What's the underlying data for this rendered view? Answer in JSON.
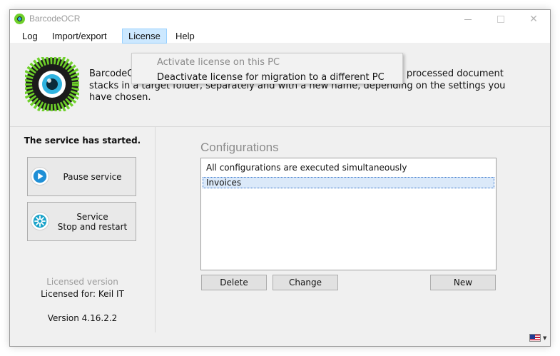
{
  "window": {
    "title": "BarcodeOCR"
  },
  "menu": {
    "log": "Log",
    "import_export": "Import/export",
    "license": "License",
    "help": "Help"
  },
  "license_menu": {
    "activate": "Activate license on this PC",
    "deactivate": "Deactivate license for migration to a different PC"
  },
  "description": "BarcodeOCR monitors input folders you have specified and files the processed document stacks in a target folder, separately and with a new name, depending on the settings you have chosen.",
  "service": {
    "status": "The service has started.",
    "pause_label": "Pause service",
    "restart_line1": "Service",
    "restart_line2": "Stop and restart"
  },
  "license": {
    "licensed_version": "Licensed version",
    "licensed_for": "Licensed for: Keil IT",
    "version": "Version 4.16.2.2"
  },
  "configurations": {
    "title": "Configurations",
    "hint": "All configurations are executed simultaneously",
    "items": [
      "Invoices"
    ],
    "delete_label": "Delete",
    "change_label": "Change",
    "new_label": "New"
  },
  "colors": {
    "logo_green": "#6ed02a",
    "logo_blue": "#2fb3e0",
    "menu_highlight": "#cce8ff",
    "selection": "#dbe9f9"
  },
  "icons": {
    "pause": "play-circle-icon",
    "restart": "gear-icon",
    "language": "us-flag-icon"
  }
}
